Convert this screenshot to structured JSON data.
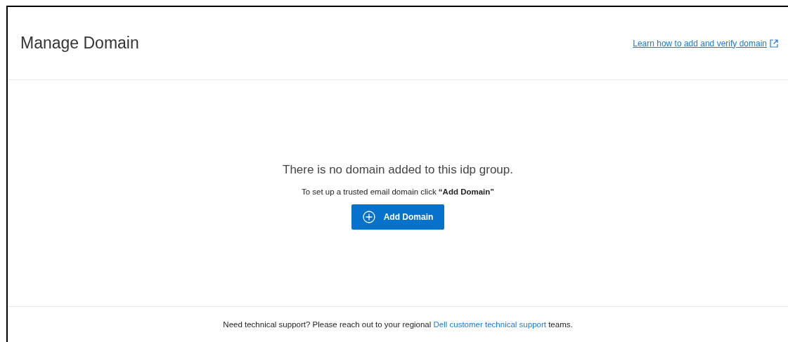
{
  "header": {
    "title": "Manage Domain",
    "help_link": "Learn how to add and verify domain"
  },
  "empty_state": {
    "heading": "There is no domain added to this idp group.",
    "instruction": "To set up a trusted email domain click **“Add Domain”**",
    "button": "Add Domain"
  },
  "footer": {
    "prefix": "Need technical support? Please reach out to your regional ",
    "link": "Dell customer technical support",
    "suffix": " teams."
  }
}
